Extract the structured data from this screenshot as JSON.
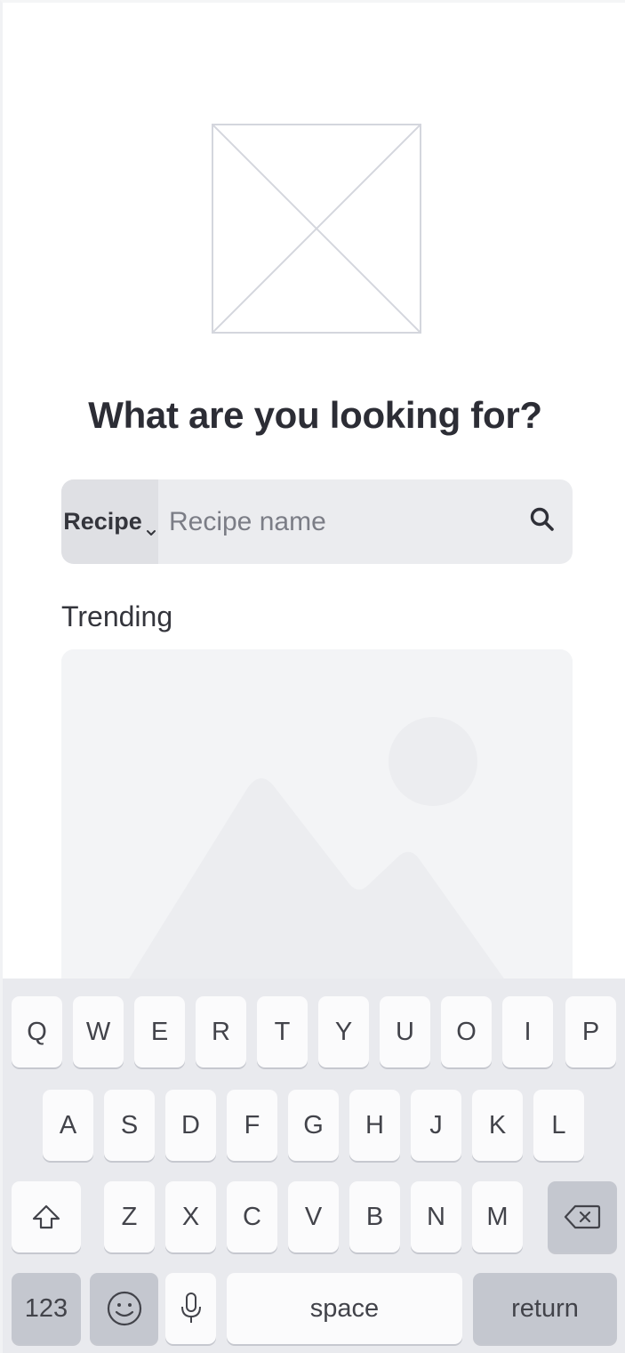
{
  "app": {
    "heading": "What are you looking for?"
  },
  "search": {
    "scope_label": "Recipe",
    "placeholder": "Recipe name",
    "value": ""
  },
  "trending": {
    "label": "Trending"
  },
  "keyboard": {
    "row1": [
      "Q",
      "W",
      "E",
      "R",
      "T",
      "Y",
      "U",
      "O",
      "I",
      "P"
    ],
    "row2": [
      "A",
      "S",
      "D",
      "F",
      "G",
      "H",
      "J",
      "K",
      "L"
    ],
    "row3": [
      "Z",
      "X",
      "C",
      "V",
      "B",
      "N",
      "M"
    ],
    "numbers_label": "123",
    "space_label": "space",
    "return_label": "return"
  },
  "colors": {
    "accent_gray": "#ebecef",
    "key_background": "#fbfbfc",
    "keyboard_background": "#e9eaee",
    "heading_color": "#2c2d35"
  },
  "icons": {
    "logo": "image-placeholder-icon",
    "search": "search-icon",
    "caret": "chevron-down-icon",
    "shift": "shift-icon",
    "backspace": "backspace-icon",
    "emoji": "emoji-icon",
    "mic": "microphone-icon"
  }
}
